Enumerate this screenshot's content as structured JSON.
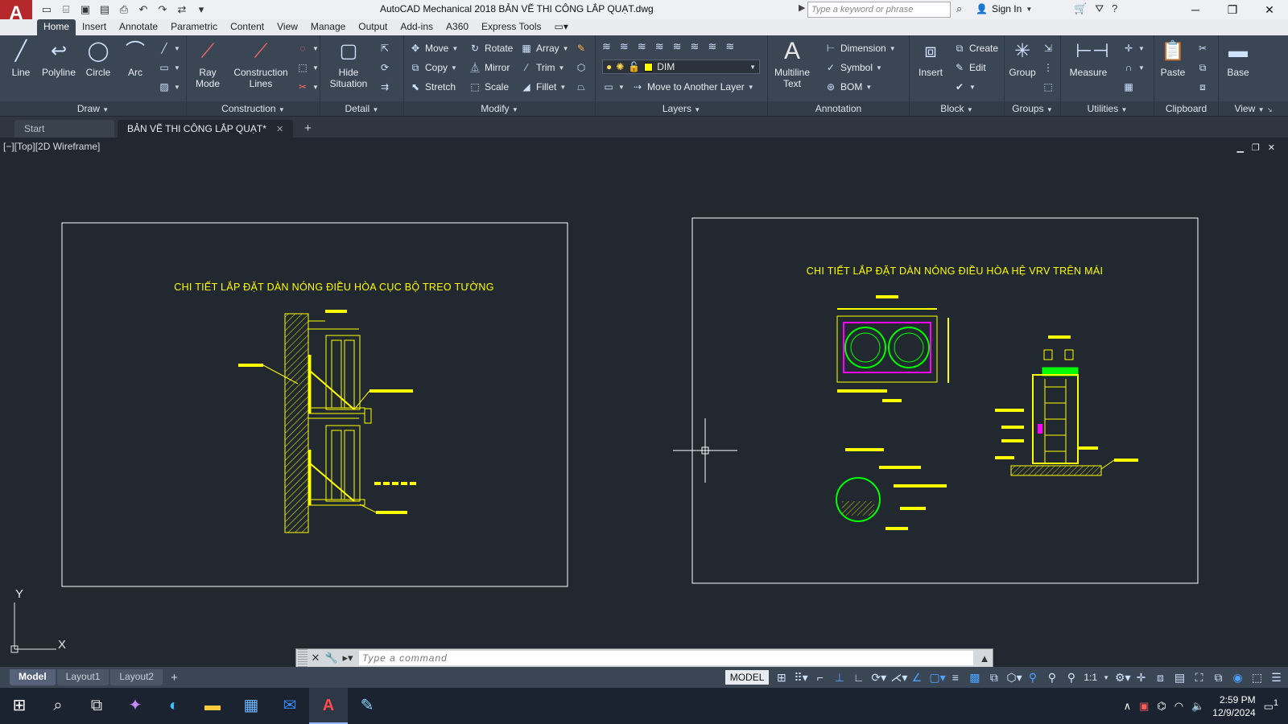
{
  "titlebar": {
    "app_logo": "A",
    "app_logo_sub": "M",
    "title": "AutoCAD Mechanical 2018    BẢN VẼ THI CÔNG LẮP QUẠT.dwg",
    "search_placeholder": "Type a keyword or phrase",
    "sign_in": "Sign In"
  },
  "ribbon_tabs": [
    "Home",
    "Insert",
    "Annotate",
    "Parametric",
    "Content",
    "View",
    "Manage",
    "Output",
    "Add-ins",
    "A360",
    "Express Tools"
  ],
  "ribbon": {
    "draw": {
      "title": "Draw",
      "line": "Line",
      "polyline": "Polyline",
      "circle": "Circle",
      "arc": "Arc"
    },
    "construction": {
      "title": "Construction",
      "ray_mode": "Ray Mode",
      "construction_lines": "Construction Lines"
    },
    "detail": {
      "title": "Detail",
      "hide_situation": "Hide Situation"
    },
    "modify": {
      "title": "Modify",
      "move": "Move",
      "rotate": "Rotate",
      "array": "Array",
      "copy": "Copy",
      "mirror": "Mirror",
      "trim": "Trim",
      "stretch": "Stretch",
      "scale": "Scale",
      "fillet": "Fillet"
    },
    "layers": {
      "title": "Layers",
      "current_layer": "DIM",
      "move_to_another_layer": "Move to Another Layer"
    },
    "annotation": {
      "title": "Annotation",
      "multiline_text": "Multiline Text",
      "dimension": "Dimension",
      "symbol": "Symbol",
      "bom": "BOM"
    },
    "block": {
      "title": "Block",
      "insert": "Insert",
      "create": "Create",
      "edit": "Edit"
    },
    "groups": {
      "title": "Groups",
      "group": "Group"
    },
    "utilities": {
      "title": "Utilities",
      "measure": "Measure"
    },
    "clipboard": {
      "title": "Clipboard",
      "paste": "Paste"
    },
    "view": {
      "title": "View",
      "base": "Base"
    }
  },
  "file_tabs": {
    "start": "Start",
    "active": "BẢN VẼ THI CÔNG LẮP QUẠT*"
  },
  "canvas": {
    "viewport_label": "[−][Top][2D Wireframe]",
    "left_title": "CHI TIẾT LẮP ĐẶT DÀN NÓNG ĐIỀU HÒA CỤC BỘ TREO TƯỜNG",
    "right_title": "CHI TIẾT LẮP ĐẶT DÀN NÓNG ĐIỀU HÒA HỆ VRV TRÊN MÁI",
    "ucs_x": "X",
    "ucs_y": "Y"
  },
  "command": {
    "placeholder": "Type a command"
  },
  "layout_tabs": [
    "Model",
    "Layout1",
    "Layout2"
  ],
  "status": {
    "model": "MODEL",
    "scale": "1:1"
  },
  "taskbar": {
    "time": "2:59 PM",
    "date": "12/9/2024",
    "notifications": "1"
  },
  "colors": {
    "canvas_bg": "#212830",
    "ribbon_bg": "#3b4655",
    "cad_yellow": "#ffff00",
    "cad_green": "#00ff00",
    "cad_magenta": "#ff00ff",
    "app_red": "#b5282b"
  }
}
